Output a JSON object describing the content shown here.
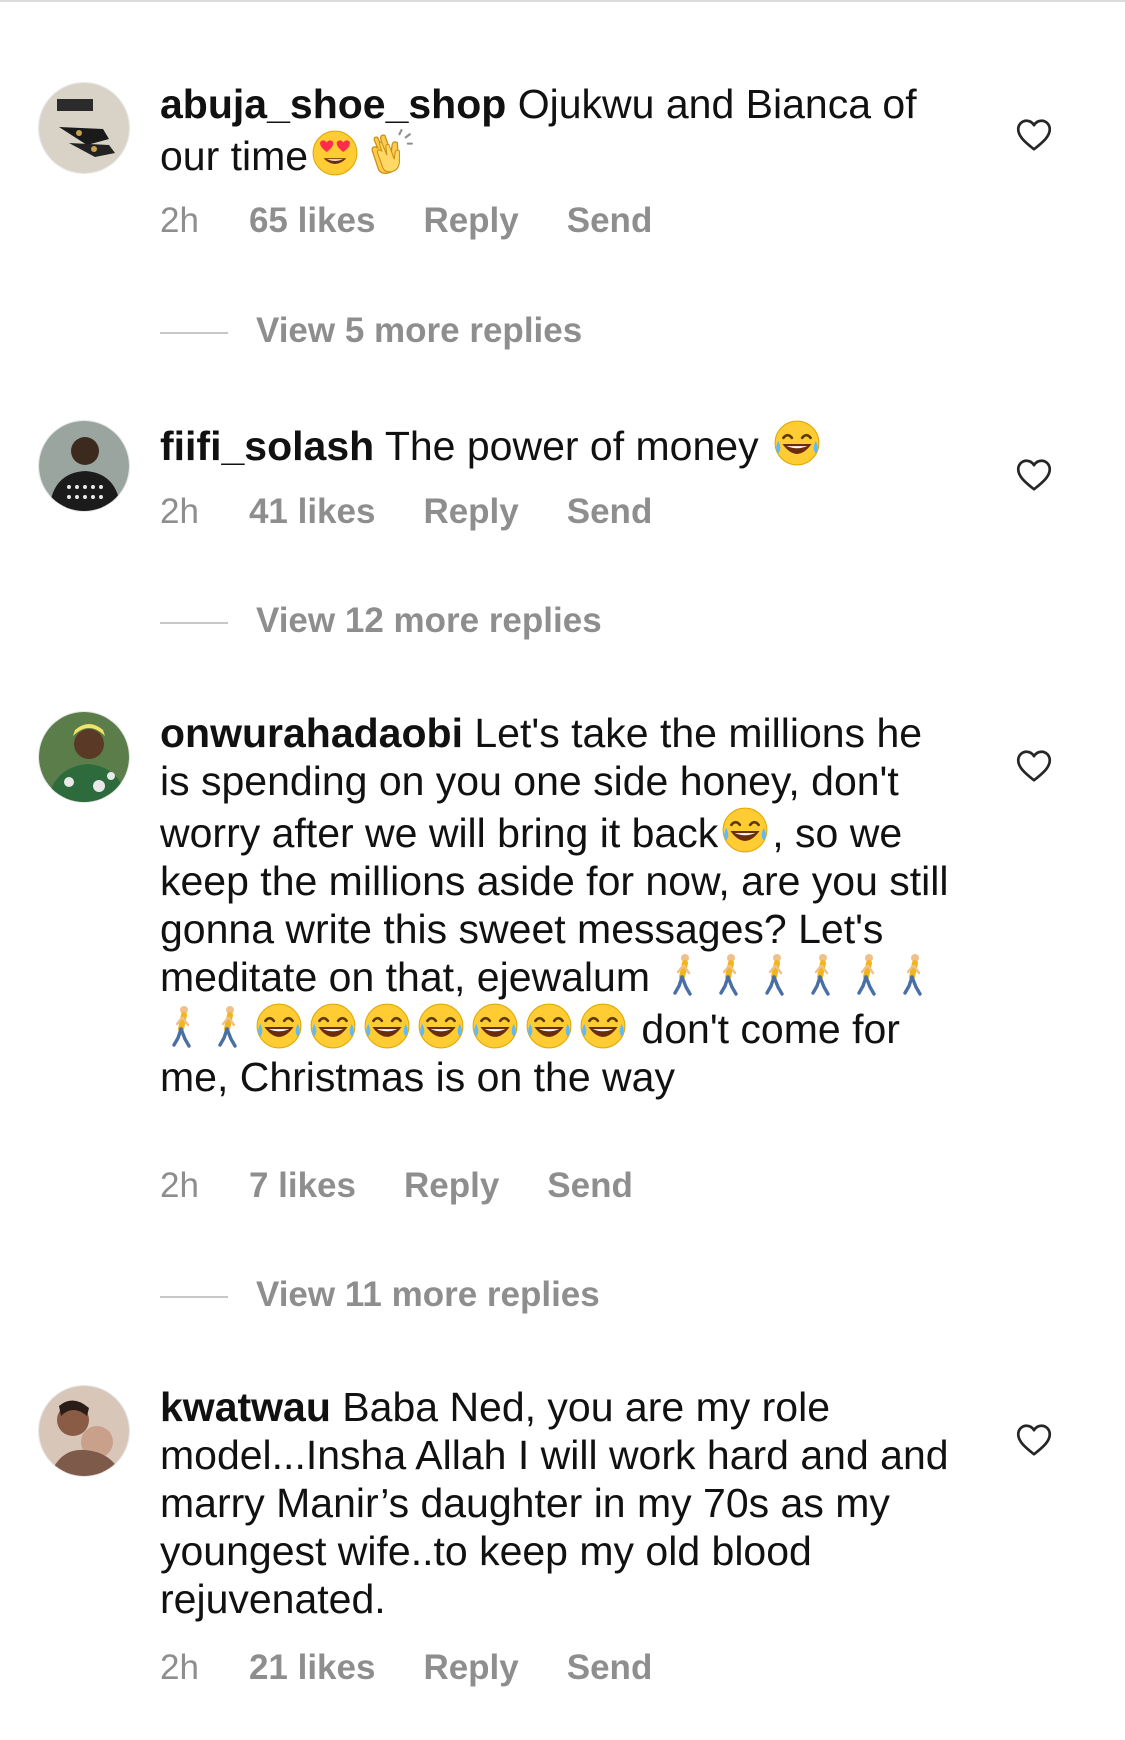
{
  "comments": [
    {
      "username": "abuja_shoe_shop",
      "text_parts": [
        "Ojukwu and Bianca of our time"
      ],
      "time": "2h",
      "likes": "65 likes",
      "reply": "Reply",
      "send": "Send",
      "view_replies": "View 5 more replies",
      "emojis": [
        "heart-eyes-emoji",
        "clapping-hands-emoji"
      ]
    },
    {
      "username": "fiifi_solash",
      "text_parts": [
        "The power of money"
      ],
      "time": "2h",
      "likes": "41 likes",
      "reply": "Reply",
      "send": "Send",
      "view_replies": "View 12 more replies",
      "emojis": [
        "tears-of-joy-emoji"
      ]
    },
    {
      "username": "onwurahadaobi",
      "text_parts": [
        "Let's take the millions he is spending on you one side honey, don't worry after we will bring it back",
        ", so we keep the millions aside for now, are you still gonna write this sweet messages? Let's meditate on that, ejewalum",
        "don't come for me, Christmas is on the way"
      ],
      "time": "2h",
      "likes": "7 likes",
      "reply": "Reply",
      "send": "Send",
      "view_replies": "View 11 more replies",
      "emojis": [
        "tears-of-joy-emoji",
        "person-walking-emoji"
      ]
    },
    {
      "username": "kwatwau",
      "text_parts": [
        "Baba Ned, you are my role model...Insha Allah I will work hard and and marry Manir’s daughter in my 70s as my youngest wife..to keep my old blood rejuvenated."
      ],
      "time": "2h",
      "likes": "21 likes",
      "reply": "Reply",
      "send": "Send"
    }
  ],
  "colors": {
    "text": "#111111",
    "meta": "#8e8e8e",
    "divider": "#c7c7c7",
    "emoji_yellow": "#ffcc33"
  },
  "icons": {
    "like": "heart-outline-icon"
  }
}
